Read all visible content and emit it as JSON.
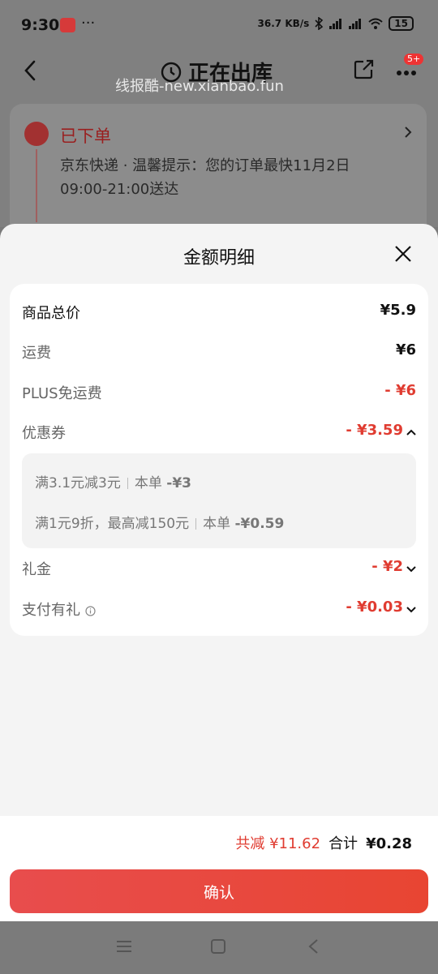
{
  "status_bar": {
    "time": "9:30",
    "more": "···",
    "network_speed": "36.7 KB/s",
    "battery": "15"
  },
  "nav": {
    "title": "正在出库",
    "badge": "5+"
  },
  "watermark": "线报酷-new.xianbao.fun",
  "order": {
    "status": "已下单",
    "description": "京东快递 · 温馨提示：您的订单最快11月2日09:00-21:00送达"
  },
  "sheet": {
    "title": "金额明细",
    "rows": [
      {
        "label": "商品总价",
        "value": "¥5.9"
      },
      {
        "label": "运费",
        "value": "¥6"
      },
      {
        "label": "PLUS免运费",
        "value": "- ¥6"
      },
      {
        "label": "优惠券",
        "value": "- ¥3.59"
      },
      {
        "label": "礼金",
        "value": "- ¥2"
      },
      {
        "label": "支付有礼",
        "value": "- ¥0.03"
      }
    ],
    "coupons": [
      {
        "name": "满3.1元减3元",
        "note": "本单",
        "amount": "-¥3"
      },
      {
        "name": "满1元9折，最高减150元",
        "note": "本单",
        "amount": "-¥0.59"
      }
    ]
  },
  "footer": {
    "total_reduce": "共减 ¥11.62",
    "total_label": "合计",
    "total_amount": "¥0.28",
    "confirm_label": "确认"
  },
  "colors": {
    "accent_red": "#e03c31",
    "button_red": "#e84d4d"
  }
}
